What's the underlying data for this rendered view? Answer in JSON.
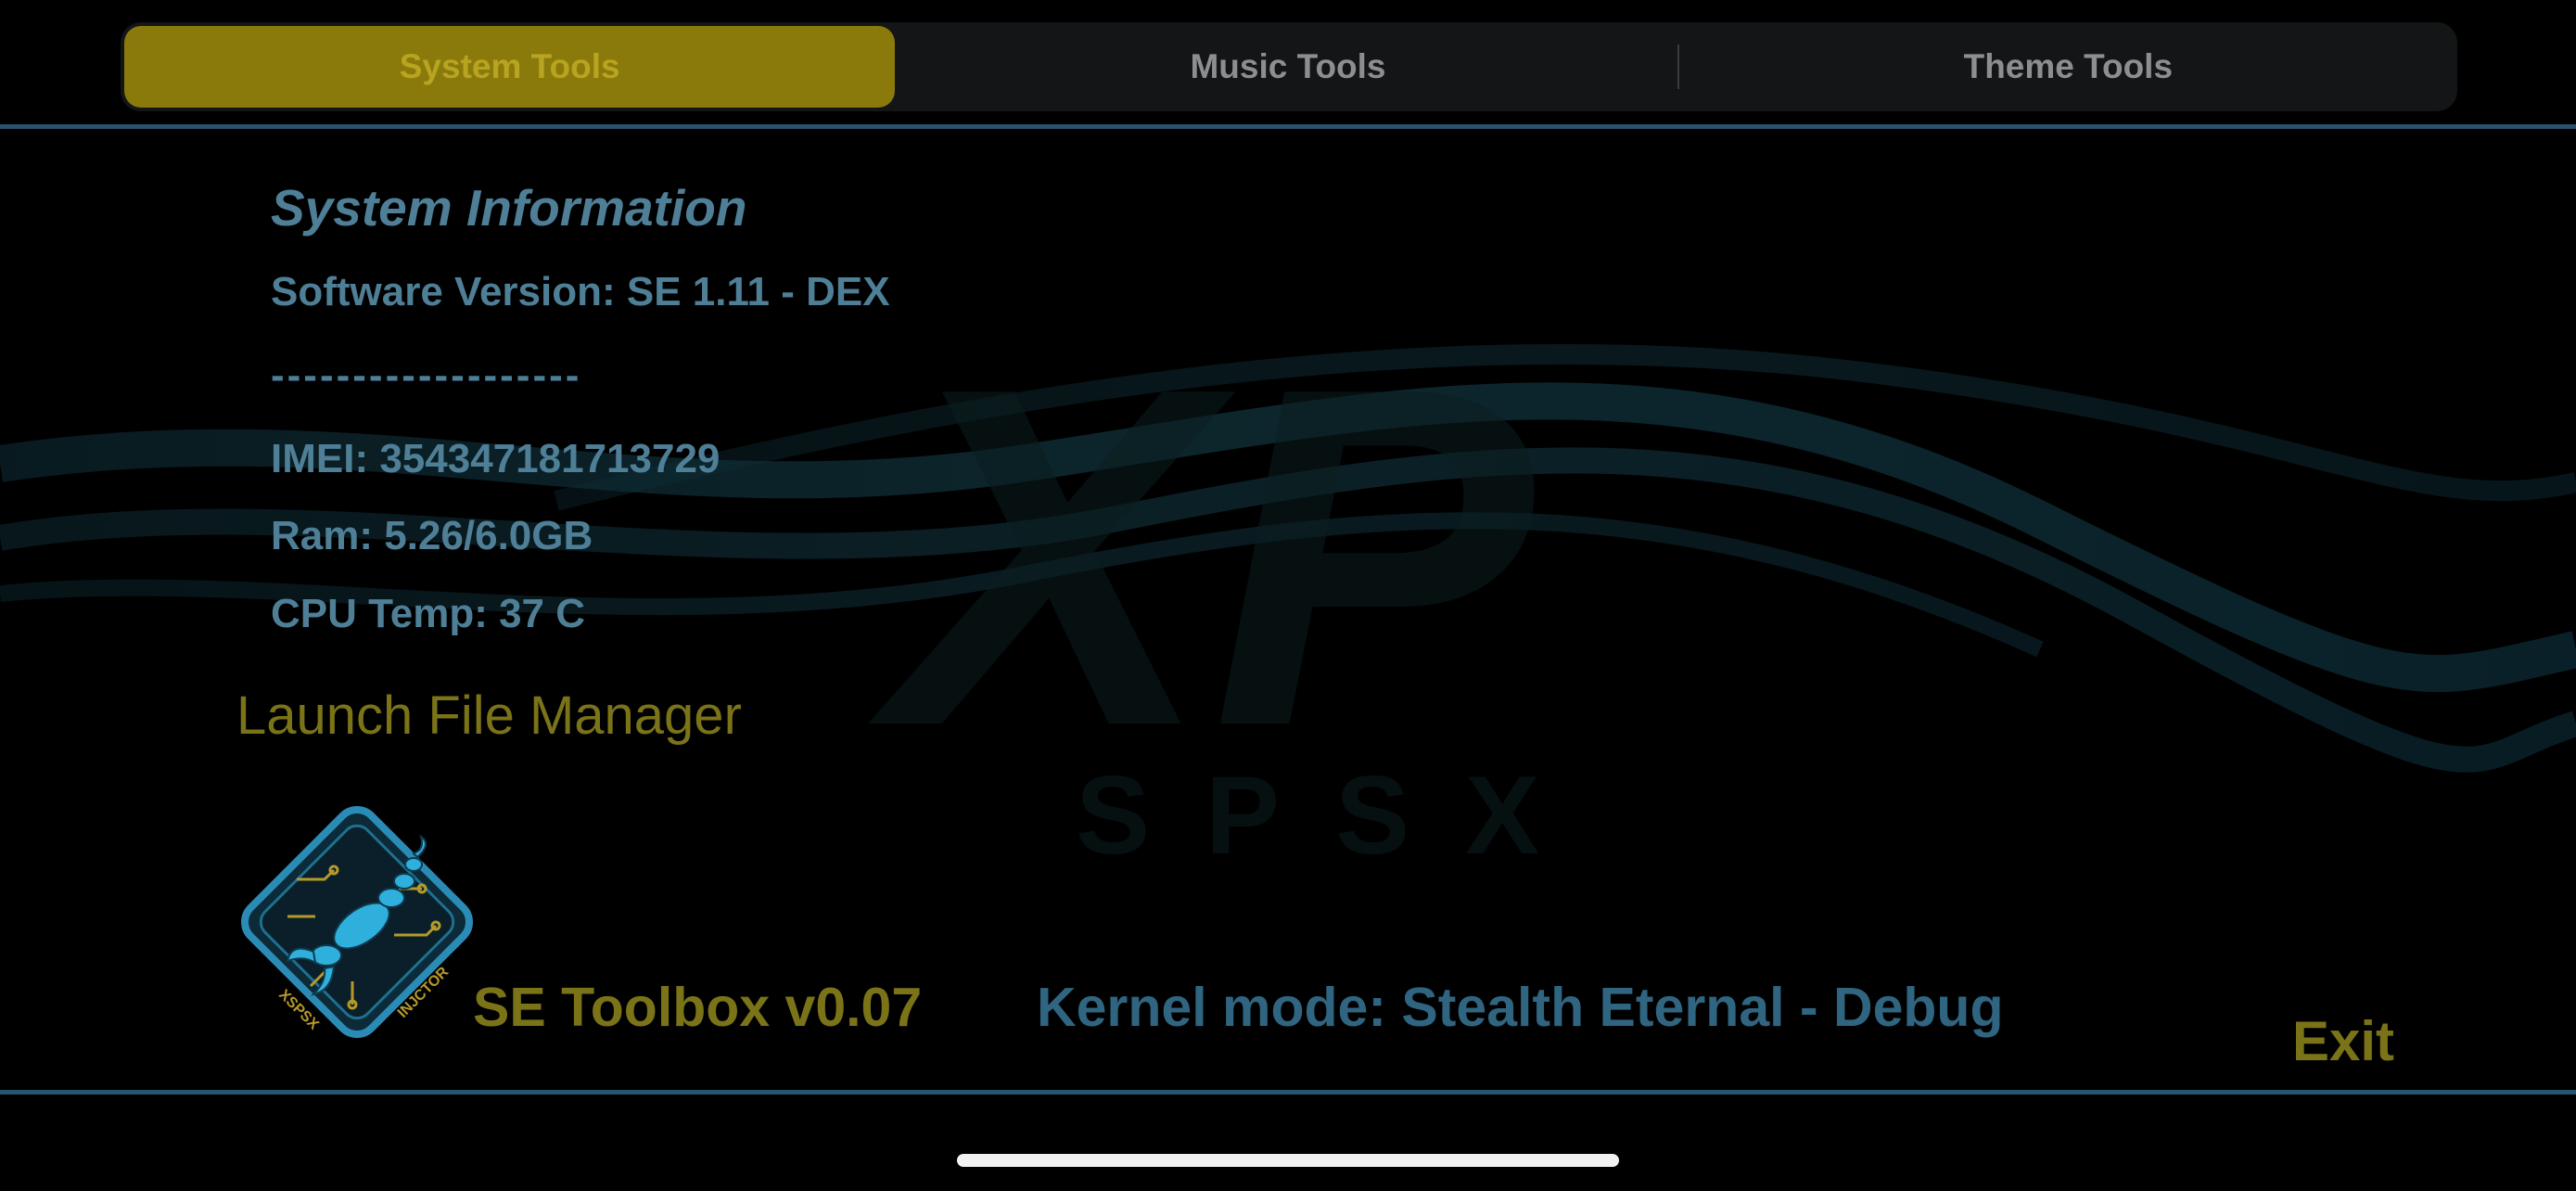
{
  "tabs": [
    {
      "label": "System Tools",
      "active": true
    },
    {
      "label": "Music Tools",
      "active": false
    },
    {
      "label": "Theme Tools",
      "active": false
    }
  ],
  "system_info": {
    "title": "System Information",
    "software_version": "Software Version: SE 1.11 - DEX",
    "separator": "-------------------",
    "imei": "IMEI: 354347181713729",
    "ram": "Ram: 5.26/6.0GB",
    "cpu_temp": "CPU Temp: 37 C"
  },
  "actions": {
    "launch_file_manager": "Launch File Manager",
    "exit": "Exit"
  },
  "footer": {
    "toolbox_label": "SE Toolbox v0.07",
    "kernel_mode": "Kernel mode: Stealth Eternal - Debug"
  },
  "watermark": {
    "big_text": "XP",
    "sub_text": "SPSX"
  },
  "logo": {
    "text_left": "XSPSX",
    "text_right": "INJCTOR",
    "icon": "scorpion-circuit-icon"
  },
  "colors": {
    "accent_gold": "#8a7a0c",
    "text_gold": "#7a7318",
    "text_blue": "#4e7f97",
    "divider": "#27536d"
  }
}
